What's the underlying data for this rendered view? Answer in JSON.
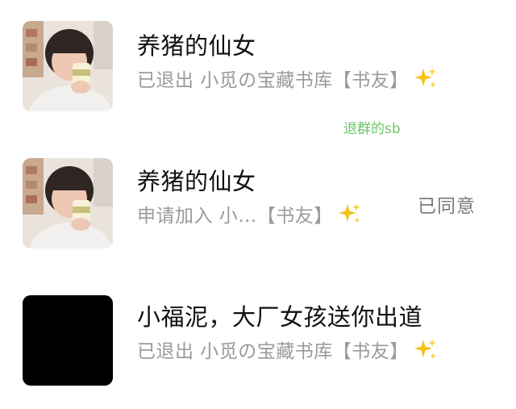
{
  "requests": [
    {
      "name": "养猪的仙女",
      "subtitle": "已退出 小觅の宝藏书库【书友】",
      "note": "退群的sb",
      "avatar_icon": "girl-photo-avatar"
    },
    {
      "name": "养猪的仙女",
      "subtitle": "申请加入 小…【书友】",
      "status": "已同意",
      "avatar_icon": "girl-photo-avatar"
    },
    {
      "name": "小福泥，大厂女孩送你出道",
      "subtitle": "已退出 小觅の宝藏书库【书友】",
      "avatar_icon": "black-avatar"
    }
  ],
  "emoji": "sparkles-icon",
  "colors": {
    "note_green": "#6fc46a",
    "subtitle_gray": "#9a9a9a",
    "sparkle_yellow": "#f2c21b"
  }
}
